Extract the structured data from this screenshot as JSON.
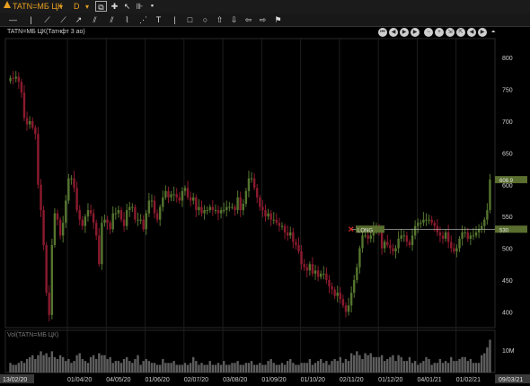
{
  "toolbar": {
    "symbol": "TATN=МБ ЦК",
    "timeframe": "D",
    "icons_row1": [
      "symbol-dropdown-icon",
      "timeframe-dropdown-icon",
      "copy-icon",
      "crosshair-icon",
      "zigzag-icon",
      "pointer-icon",
      "bars-icon",
      "blank-square-icon"
    ],
    "icons_row2": [
      "horizontal-line-icon",
      "vertical-line-icon",
      "trend-line-icon",
      "ray-icon",
      "arrow-line-icon",
      "channel-icon",
      "fibonacci-icon",
      "text-icon",
      "rectangle-icon",
      "circle-icon",
      "arrow-up-icon",
      "arrow-down-icon",
      "arrow-left-icon",
      "arrow-right-icon",
      "flag-icon"
    ]
  },
  "navigation": [
    "first-icon",
    "rewind-icon",
    "play-icon",
    "forward-icon",
    "zoom-out-icon",
    "zoom-in-icon",
    "collapse-icon",
    "expand-icon",
    "scroll-back-icon",
    "scroll-forward-icon",
    "last-icon",
    "pin-icon"
  ],
  "colors": {
    "up": "#55752f",
    "down": "#8b1a2e",
    "grid": "#1e1e1e",
    "price_tag": "#5a6e2f",
    "long_tag": "#5a6e2f",
    "volume": "#5e5e5e"
  },
  "chart_data": {
    "type": "candlestick",
    "title": "TATN=МБ ЦК(Татнфт 3 ао)",
    "ylim": [
      375,
      830
    ],
    "y_ticks": [
      400,
      450,
      500,
      550,
      600,
      650,
      700,
      750,
      800
    ],
    "x_ticks": [
      "01/04/20",
      "04/05/20",
      "01/06/20",
      "02/07/20",
      "03/08/20",
      "01/09/20",
      "01/10/20",
      "02/11/20",
      "01/12/20",
      "04/01/21",
      "01/02/21"
    ],
    "start_date": "13/02/20",
    "end_date": "09/03/21",
    "last_price_label": "608.9",
    "long_price_label": "530",
    "long_label": "LONG",
    "long_price": 530,
    "close": [
      768,
      767,
      770,
      762,
      745,
      705,
      695,
      700,
      690,
      680,
      600,
      560,
      505,
      430,
      395,
      505,
      555,
      545,
      520,
      540,
      575,
      610,
      610,
      595,
      560,
      545,
      535,
      550,
      560,
      555,
      540,
      520,
      475,
      540,
      545,
      540,
      530,
      555,
      555,
      560,
      545,
      535,
      560,
      565,
      565,
      545,
      545,
      545,
      530,
      555,
      575,
      575,
      555,
      545,
      565,
      580,
      590,
      580,
      585,
      585,
      580,
      575,
      590,
      595,
      580,
      575,
      580,
      560,
      565,
      555,
      560,
      560,
      565,
      560,
      560,
      555,
      560,
      560,
      565,
      565,
      565,
      560,
      580,
      560,
      570,
      590,
      610,
      610,
      595,
      580,
      565,
      560,
      550,
      555,
      545,
      545,
      540,
      535,
      535,
      525,
      520,
      525,
      510,
      505,
      495,
      475,
      470,
      465,
      475,
      460,
      465,
      455,
      460,
      460,
      450,
      440,
      435,
      425,
      430,
      420,
      410,
      400,
      410,
      430,
      450,
      470,
      500,
      520,
      520,
      515,
      520,
      530,
      530,
      525,
      500,
      510,
      505,
      500,
      495,
      500,
      515,
      520,
      520,
      510,
      505,
      520,
      535,
      540,
      540,
      545,
      545,
      545,
      540,
      535,
      525,
      520,
      515,
      525,
      510,
      500,
      495,
      500,
      515,
      525,
      525,
      515,
      520,
      520,
      525,
      530,
      535,
      545,
      560,
      608
    ],
    "volume": [
      5,
      4,
      4,
      5,
      6,
      5,
      7,
      8,
      9,
      7,
      9,
      11,
      9,
      10,
      8,
      11,
      8,
      7,
      9,
      8,
      6,
      7,
      5,
      6,
      9,
      10,
      7,
      6,
      5,
      8,
      9,
      7,
      10,
      9,
      9,
      7,
      8,
      5,
      6,
      6,
      5,
      7,
      8,
      6,
      5,
      7,
      9,
      4,
      6,
      7,
      6,
      5,
      5,
      4,
      4,
      7,
      5,
      5,
      5,
      6,
      4,
      4,
      4,
      5,
      4,
      5,
      8,
      6,
      4,
      5,
      4,
      4,
      6,
      4,
      4,
      5,
      4,
      6,
      4,
      4,
      5,
      5,
      6,
      4,
      4,
      5,
      5,
      6,
      4,
      4,
      5,
      4,
      4,
      6,
      7,
      5,
      4,
      4,
      5,
      4,
      6,
      7,
      5,
      4,
      4,
      5,
      5,
      5,
      7,
      4,
      5,
      6,
      7,
      5,
      6,
      4,
      6,
      7,
      6,
      8,
      5,
      7,
      6,
      10,
      9,
      11,
      9,
      7,
      10,
      9,
      10,
      8,
      8,
      8,
      9,
      6,
      7,
      8,
      9,
      6,
      9,
      8,
      6,
      6,
      8,
      5,
      6,
      4,
      5,
      6,
      8,
      7,
      4,
      5,
      5,
      7,
      5,
      6,
      5,
      8,
      6,
      6,
      7,
      8,
      8,
      6,
      7,
      5,
      5,
      5,
      9,
      10,
      13,
      17
    ],
    "volume_title": "Vol(TATN=МБ ЦК)",
    "volume_tick": "10M"
  }
}
